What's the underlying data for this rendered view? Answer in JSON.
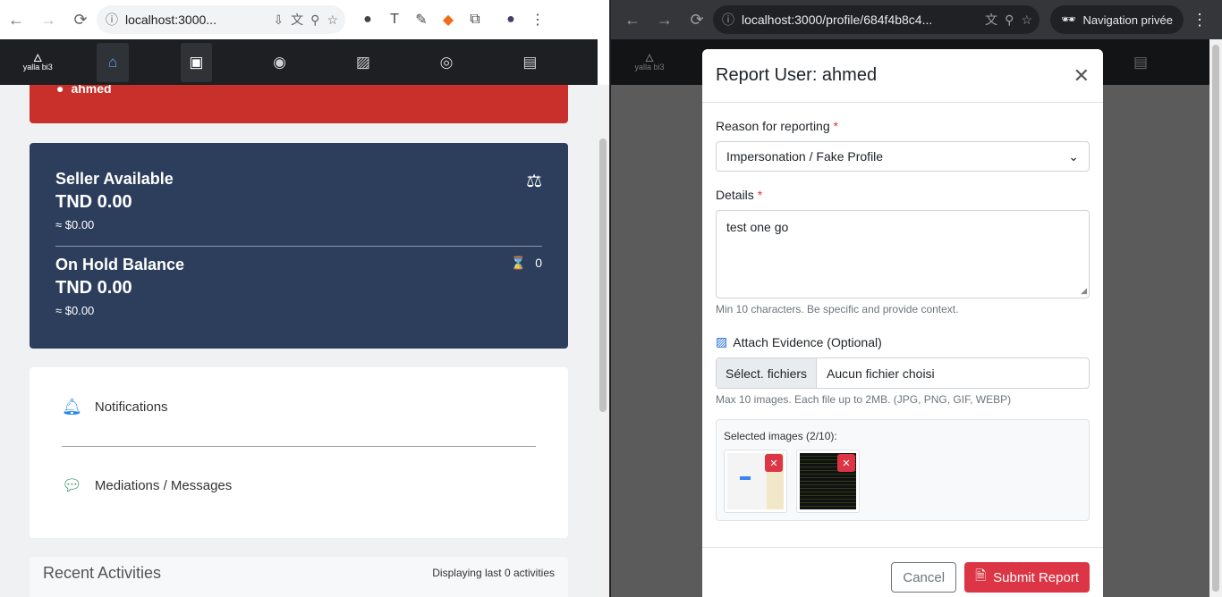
{
  "left_window": {
    "url": "localhost:3000...",
    "user_name": "ahmed",
    "seller_available": {
      "label": "Seller Available",
      "amount": "TND 0.00",
      "usd": "≈ $0.00"
    },
    "on_hold": {
      "label": "On Hold Balance",
      "amount": "TND 0.00",
      "usd": "≈ $0.00",
      "count": "0"
    },
    "links": [
      {
        "label": "Notifications",
        "icon": "bell-icon",
        "color": "#1e88e5"
      },
      {
        "label": "Mediations / Messages",
        "icon": "comments-icon",
        "color": "#2e8b57"
      }
    ],
    "recent": {
      "title": "Recent Activities",
      "subtitle": "Displaying last 0 activities"
    }
  },
  "right_window": {
    "url": "localhost:3000/profile/684f4b8c4...",
    "incognito_label": "Navigation privée"
  },
  "logo_text": "yalla bi3",
  "modal": {
    "title": "Report User: ahmed",
    "reason_label": "Reason for reporting",
    "reason_value": "Impersonation / Fake Profile",
    "details_label": "Details",
    "details_value": "test one go",
    "details_help": "Min 10 characters. Be specific and provide context.",
    "evidence_label": "Attach Evidence (Optional)",
    "file_button": "Sélect. fichiers",
    "file_status": "Aucun fichier choisi",
    "file_help": "Max 10 images. Each file up to 2MB. (JPG, PNG, GIF, WEBP)",
    "selected_label": "Selected images (2/10):",
    "cancel_label": "Cancel",
    "submit_label": "Submit Report",
    "required_mark": "*"
  },
  "colors": {
    "danger": "#dc3545",
    "balance_bg": "#2c3e5c",
    "red_card": "#c9302c"
  }
}
